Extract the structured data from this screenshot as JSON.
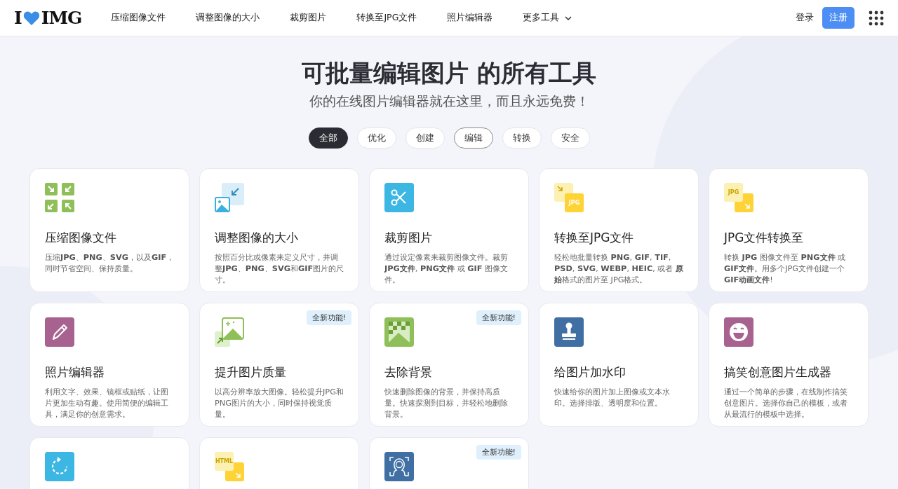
{
  "header": {
    "logo": {
      "left": "I",
      "right": "IMG"
    },
    "nav": [
      {
        "label": "压缩图像文件",
        "dropdown": false
      },
      {
        "label": "调整图像的大小",
        "dropdown": false
      },
      {
        "label": "裁剪图片",
        "dropdown": false
      },
      {
        "label": "转换至JPG文件",
        "dropdown": false
      },
      {
        "label": "照片编辑器",
        "dropdown": false
      },
      {
        "label": "更多工具",
        "dropdown": true
      }
    ],
    "login": "登录",
    "signup": "注册"
  },
  "hero": {
    "title": "可批量编辑图片 的所有工具",
    "subtitle": "你的在线图片编辑器就在这里，而且永远免费！"
  },
  "filters": [
    {
      "label": "全部",
      "selected": true,
      "focused": false
    },
    {
      "label": "优化",
      "selected": false,
      "focused": false
    },
    {
      "label": "创建",
      "selected": false,
      "focused": false
    },
    {
      "label": "编辑",
      "selected": false,
      "focused": true
    },
    {
      "label": "转换",
      "selected": false,
      "focused": false
    },
    {
      "label": "安全",
      "selected": false,
      "focused": false
    }
  ],
  "tools": [
    {
      "kind": "compress",
      "title": "压缩图像文件",
      "description": "压缩**JPG**、**PNG**、**SVG**，以及**GIF**，同时节省空间、保持质量。"
    },
    {
      "kind": "resize",
      "title": "调整图像的大小",
      "description": "按照百分比或像素来定义尺寸，并调整**JPG**、**PNG**、**SVG**和**GIF**图片的尺寸。"
    },
    {
      "kind": "crop",
      "title": "裁剪图片",
      "description": "通过设定像素来裁剪图像文件。裁剪 **JPG文件**, **PNG文件** 或 **GIF** 图像文件。"
    },
    {
      "kind": "to-format",
      "icon_label": "JPG",
      "title": "转换至JPG文件",
      "description": "轻松地批量转换 **PNG**, **GIF**, **TIF**, **PSD**, **SVG**, **WEBP**, **HEIC**, 或者 **原始**格式的图片至 JPG格式。"
    },
    {
      "kind": "from-format",
      "icon_label": "JPG",
      "title": "JPG文件转换至",
      "description": "转换 **JPG** 图像文件至 **PNG文件** 或 **GIF文件**。用多个JPG文件创建一个 **GIF动画文件**!"
    },
    {
      "kind": "edit",
      "title": "照片编辑器",
      "description": "利用文字、效果、镜框或贴纸，让图片更加生动有趣。使用简便的编辑工具，满足你的创意需求。"
    },
    {
      "kind": "upscale",
      "badge": "全新功能!",
      "title": "提升图片质量",
      "description": "以高分辨率放大图像。轻松提升JPG和PNG图片的大小，同时保持视觉质量。"
    },
    {
      "kind": "remove-bg",
      "badge": "全新功能!",
      "title": "去除背景",
      "description": "快速删除图像的背景，并保持高质量。快速探测到目标，并轻松地删除背景。"
    },
    {
      "kind": "watermark",
      "title": "给图片加水印",
      "description": "快速给你的图片加上图像或文本水印。选择排版、透明度和位置。"
    },
    {
      "kind": "meme",
      "title": "搞笑创意图片生成器",
      "description": "通过一个简单的步骤，在线制作搞笑创意图片。选择你自己的模板，或者从最流行的模板中选择。"
    },
    {
      "kind": "rotate"
    },
    {
      "kind": "from-format",
      "icon_label": "HTML"
    },
    {
      "kind": "blur-face",
      "badge": "全新功能!"
    }
  ]
}
